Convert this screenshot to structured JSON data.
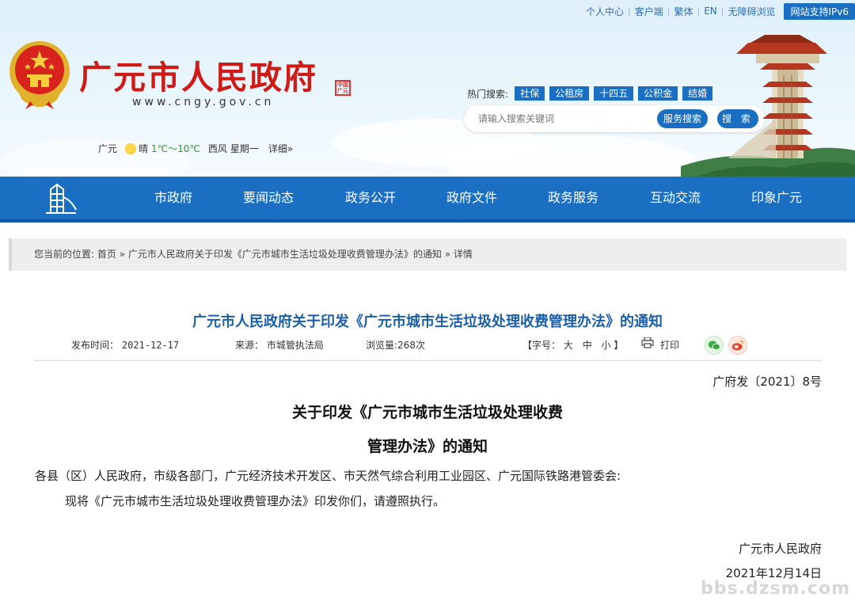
{
  "topbar": {
    "links": [
      "个人中心",
      "客户端",
      "繁体",
      "EN",
      "无障碍浏览"
    ],
    "ipv6": "网站支持IPv6"
  },
  "site": {
    "title": "广元市人民政府",
    "url": "www.cngy.gov.cn",
    "seal_text": "中国广元"
  },
  "weather": {
    "city": "广元",
    "condition": "晴",
    "temp": "1℃～10℃",
    "wind": "西风",
    "weekday": "星期一",
    "detail": "详细»"
  },
  "hot_search": {
    "label": "热门搜索:",
    "tags": [
      "社保",
      "公租房",
      "十四五",
      "公积金",
      "结婚"
    ]
  },
  "search": {
    "placeholder": "请输入搜索关键词",
    "service_button": "服务搜索",
    "search_button": "搜 索"
  },
  "nav": {
    "items": [
      "市政府",
      "要闻动态",
      "政务公开",
      "政府文件",
      "政务服务",
      "互动交流",
      "印象广元"
    ]
  },
  "breadcrumb": {
    "prefix": "您当前的位置:",
    "home": "首页",
    "sep": "»",
    "article": "广元市人民政府关于印发《广元市城市生活垃圾处理收费管理办法》的通知",
    "current": "详情"
  },
  "article": {
    "title": "广元市人民政府关于印发《广元市城市生活垃圾处理收费管理办法》的通知",
    "publish_label": "发布时间：",
    "publish_date": "2021-12-17",
    "source_label": "来源：",
    "source": "市城管执法局",
    "views_label": "浏览量:",
    "views": "268次",
    "font_label": "【字号：",
    "font_large": "大",
    "font_medium": "中",
    "font_small": "小",
    "font_close": "】",
    "print": "打印"
  },
  "doc": {
    "number": "广府发〔2021〕8号",
    "heading_line1": "关于印发《广元市城市生活垃圾处理收费",
    "heading_line2": "管理办法》的通知",
    "salutation": "各县（区）人民政府，市级各部门，广元经济技术开发区、市天然气综合利用工业园区、广元国际铁路港管委会:",
    "body": "现将《广元市城市生活垃圾处理收费管理办法》印发你们，请遵照执行。",
    "signer": "广元市人民政府",
    "date": "2021年12月14日"
  },
  "watermark": "bbs.dzsm.com",
  "colors": {
    "brand_blue": "#1a6fc2",
    "title_red": "#cf1a15",
    "article_title_blue": "#1a5fa8"
  }
}
